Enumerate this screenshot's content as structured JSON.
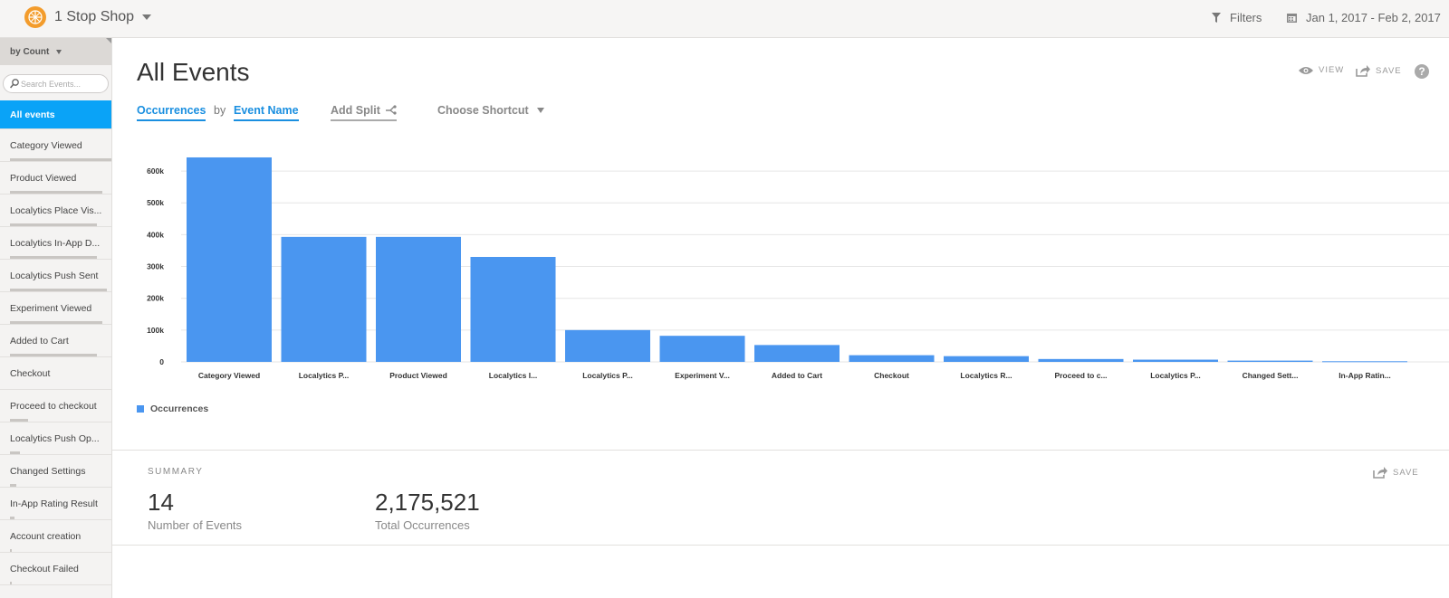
{
  "header": {
    "app_name": "1 Stop Shop",
    "filters_label": "Filters",
    "date_range": "Jan 1, 2017 - Feb 2, 2017"
  },
  "sidebar": {
    "sort_label": "by Count",
    "search_placeholder": "Search Events...",
    "items": [
      {
        "label": "All events",
        "active": true,
        "share": 0
      },
      {
        "label": "Category Viewed",
        "share": 1.0
      },
      {
        "label": "Product Viewed",
        "share": 0.9
      },
      {
        "label": "Localytics Place Vis...",
        "share": 0.85
      },
      {
        "label": "Localytics In-App D...",
        "share": 0.85
      },
      {
        "label": "Localytics Push Sent",
        "share": 0.95
      },
      {
        "label": "Experiment Viewed",
        "share": 0.9
      },
      {
        "label": "Added to Cart",
        "share": 0.85
      },
      {
        "label": "Checkout",
        "share": 0
      },
      {
        "label": "Proceed to checkout",
        "share": 0.18
      },
      {
        "label": "Localytics Push Op...",
        "share": 0.1
      },
      {
        "label": "Changed Settings",
        "share": 0.06
      },
      {
        "label": "In-App Rating Result",
        "share": 0.04
      },
      {
        "label": "Account creation",
        "share": 0.02
      },
      {
        "label": "Checkout Failed",
        "share": 0.02
      }
    ]
  },
  "main": {
    "title": "All Events",
    "view_label": "VIEW",
    "save_label": "SAVE",
    "help_label": "?",
    "metric": "Occurrences",
    "by_label": "by",
    "dimension": "Event Name",
    "add_split": "Add Split",
    "shortcut": "Choose Shortcut"
  },
  "chart_data": {
    "type": "bar",
    "categories": [
      "Category Viewed",
      "Localytics P...",
      "Product Viewed",
      "Localytics I...",
      "Localytics P...",
      "Experiment V...",
      "Added to Cart",
      "Checkout",
      "Localytics R...",
      "Proceed to c...",
      "Localytics P...",
      "Changed Sett...",
      "In-App Ratin..."
    ],
    "series": [
      {
        "name": "Occurrences",
        "values": [
          643000,
          393000,
          393000,
          330000,
          100000,
          82000,
          53000,
          21000,
          18000,
          9000,
          7000,
          4000,
          2000
        ]
      }
    ],
    "yticks": [
      0,
      100000,
      200000,
      300000,
      400000,
      500000,
      600000
    ],
    "ytick_labels": [
      "0",
      "100k",
      "200k",
      "300k",
      "400k",
      "500k",
      "600k"
    ],
    "ylim": [
      0,
      660000
    ],
    "grid": true,
    "legend": "bottom-left",
    "color": "#4a96f0"
  },
  "summary": {
    "label": "SUMMARY",
    "save_label": "SAVE",
    "stats": [
      {
        "value": "14",
        "label": "Number of Events"
      },
      {
        "value": "2,175,521",
        "label": "Total Occurrences"
      }
    ]
  }
}
